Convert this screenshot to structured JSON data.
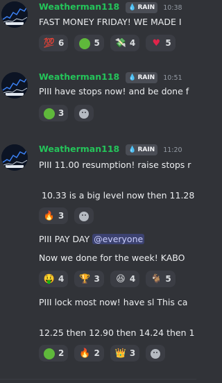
{
  "messages": [
    {
      "username": "Weatherman118",
      "tag": "RAIN",
      "time": "10:38",
      "lines": [
        "FAST MONEY FRIDAY! WE MADE I"
      ],
      "reactions": [
        {
          "emoji": "💯",
          "count": "6"
        },
        {
          "emoji": "green-circle",
          "count": "5"
        },
        {
          "emoji": "💸",
          "count": "4"
        },
        {
          "emoji": "❤️",
          "count": "5"
        }
      ]
    },
    {
      "username": "Weatherman118",
      "tag": "RAIN",
      "time": "10:51",
      "lines": [
        "PIII have stops now! and be done f"
      ],
      "reactions": [
        {
          "emoji": "green-circle",
          "count": "3"
        }
      ]
    },
    {
      "username": "Weatherman118",
      "tag": "RAIN",
      "time": "11:20",
      "lines": [
        "PIII 11.00 resumption! raise stops r",
        "10.33  is a big level now then 11.28"
      ],
      "reactions": [
        {
          "emoji": "🔥",
          "count": "3"
        }
      ]
    }
  ],
  "followups": [
    {
      "text": "PIII PAY DAY",
      "mention": "@everyone"
    },
    {
      "text": "Now we done for the week! KABO",
      "reactions": [
        {
          "emoji": "🤑",
          "count": "4"
        },
        {
          "emoji": "🏆",
          "count": "3"
        },
        {
          "emoji": "😆",
          "count": "4"
        },
        {
          "emoji": "🐐",
          "count": "5"
        }
      ]
    },
    {
      "lines": [
        "PIII  lock most now! have sl This ca",
        "12.25 then 12.90 then 14.24 then 1"
      ],
      "reactions": [
        {
          "emoji": "green-circle",
          "count": "2"
        },
        {
          "emoji": "🔥",
          "count": "2"
        },
        {
          "emoji": "👑",
          "count": "3"
        }
      ]
    }
  ],
  "colors": {
    "background": "#313338",
    "username": "#24c45a",
    "mention_bg": "#3c4270"
  },
  "icons": {
    "add_reaction": "smile-add-icon",
    "tag": "water-drop-icon"
  }
}
